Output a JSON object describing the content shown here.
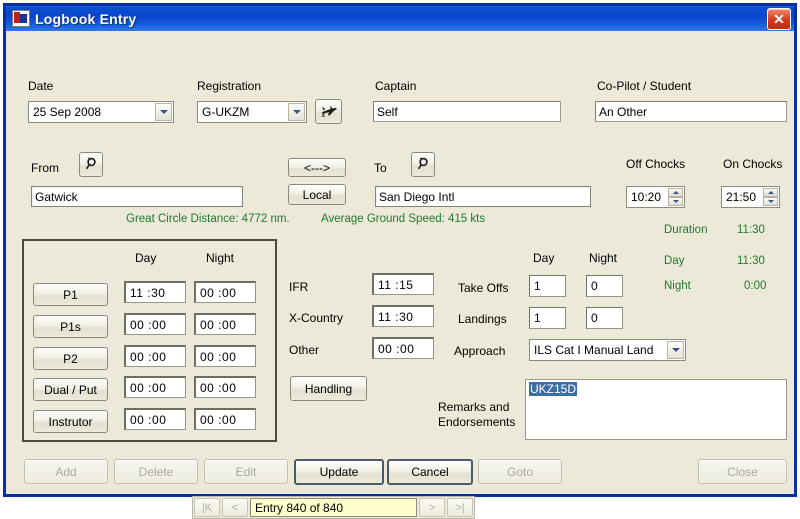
{
  "window": {
    "title": "Logbook Entry",
    "icon": "logbook-icon",
    "close_label": "✕",
    "title_bar_color": "#0a45cc",
    "face_color": "#ece9d8",
    "border_color": "#0a2ea8",
    "green_text_color": "#1f7a2e",
    "selection_color": "#3a6ea5"
  },
  "form": {
    "date": {
      "label": "Date",
      "value": "25 Sep 2008"
    },
    "registration": {
      "label": "Registration",
      "value": "G-UKZM",
      "picker_icon": "airplane-icon"
    },
    "captain": {
      "label": "Captain",
      "value": "Self"
    },
    "copilot": {
      "label": "Co-Pilot / Student",
      "value": "An Other"
    },
    "from": {
      "label": "From",
      "value": "Gatwick",
      "lookup_icon": "magnifier-icon"
    },
    "to": {
      "label": "To",
      "value": "San Diego Intl",
      "lookup_icon": "magnifier-icon"
    },
    "swap_button": "<--->",
    "local_button": "Local",
    "off_chocks": {
      "label": "Off Chocks",
      "value": "10:20"
    },
    "on_chocks": {
      "label": "On Chocks",
      "value": "21:50"
    },
    "great_circle": "Great Circle Distance: 4772 nm.",
    "average_speed": "Average Ground Speed: 415 kts"
  },
  "totals": {
    "duration_label": "Duration",
    "duration_value": "11:30",
    "day_label": "Day",
    "day_value": "11:30",
    "night_label": "Night",
    "night_value": "0:00"
  },
  "time_grid": {
    "col_day": "Day",
    "col_night": "Night",
    "rows": [
      {
        "label": "P1",
        "day": "11 :30",
        "night": "00 :00"
      },
      {
        "label": "P1s",
        "day": "00 :00",
        "night": "00 :00"
      },
      {
        "label": "P2",
        "day": "00 :00",
        "night": "00 :00"
      },
      {
        "label": "Dual / Put",
        "day": "00 :00",
        "night": "00 :00"
      },
      {
        "label": "Instrutor",
        "day": "00 :00",
        "night": "00 :00"
      }
    ]
  },
  "conditions": {
    "ifr_label": "IFR",
    "ifr_value": "11 :15",
    "xcountry_label": "X-Country",
    "xcountry_value": "11 :30",
    "other_label": "Other",
    "other_value": "00 :00",
    "handling_button": "Handling"
  },
  "ops": {
    "col_day": "Day",
    "col_night": "Night",
    "takeoffs_label": "Take Offs",
    "takeoffs_day": "1",
    "takeoffs_night": "0",
    "landings_label": "Landings",
    "landings_day": "1",
    "landings_night": "0",
    "approach_label": "Approach",
    "approach_value": "ILS Cat I Manual Land"
  },
  "remarks": {
    "label_line1": "Remarks and",
    "label_line2": "Endorsements",
    "value": "UKZ15D"
  },
  "actions": {
    "add": "Add",
    "delete": "Delete",
    "edit": "Edit",
    "update": "Update",
    "cancel": "Cancel",
    "goto": "Goto",
    "close": "Close"
  },
  "navigator": {
    "first": "|K",
    "prev": "<",
    "status": "Entry 840 of 840",
    "next": ">",
    "last": ">|"
  }
}
